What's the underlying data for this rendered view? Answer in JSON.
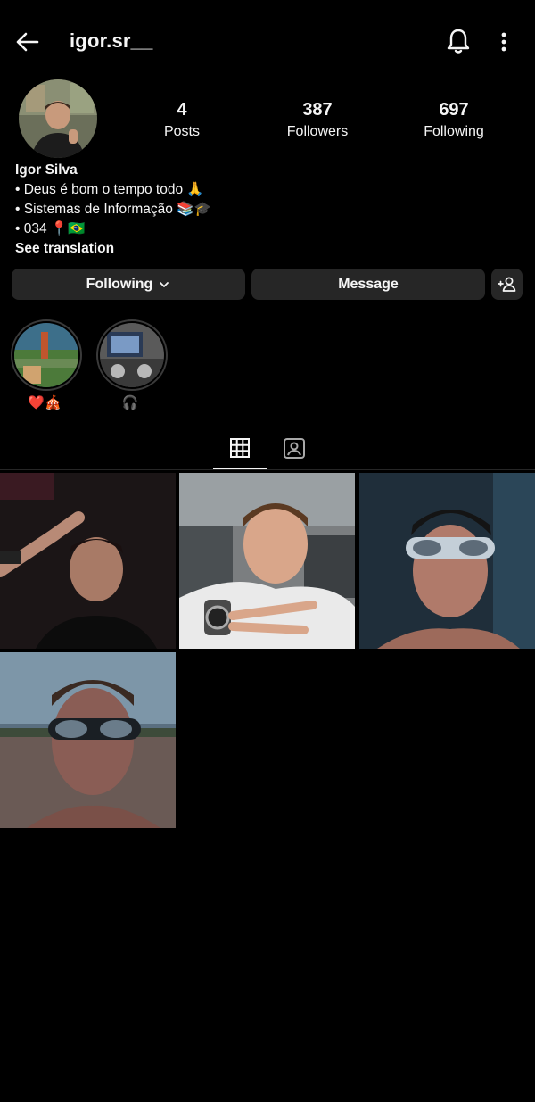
{
  "header": {
    "username": "igor.sr__"
  },
  "stats": {
    "posts": {
      "value": "4",
      "label": "Posts"
    },
    "followers": {
      "value": "387",
      "label": "Followers"
    },
    "following": {
      "value": "697",
      "label": "Following"
    }
  },
  "bio": {
    "name": "Igor Silva",
    "lines": [
      "• Deus é bom o tempo todo 🙏",
      "• Sistemas de Informação 📚🎓",
      "• 034 📍🇧🇷"
    ],
    "see_translation": "See translation"
  },
  "actions": {
    "following_label": "Following",
    "message_label": "Message"
  },
  "highlights": [
    {
      "label": "❤️🎪"
    },
    {
      "label": "🎧"
    }
  ],
  "icons": {
    "back": "arrow-left-icon",
    "bell": "bell-icon",
    "more": "more-vertical-icon",
    "add_user": "add-user-icon",
    "grid": "grid-icon",
    "tagged": "tagged-person-icon"
  },
  "colors": {
    "background": "#000000",
    "button": "#262626",
    "text": "#f5f5f5"
  }
}
